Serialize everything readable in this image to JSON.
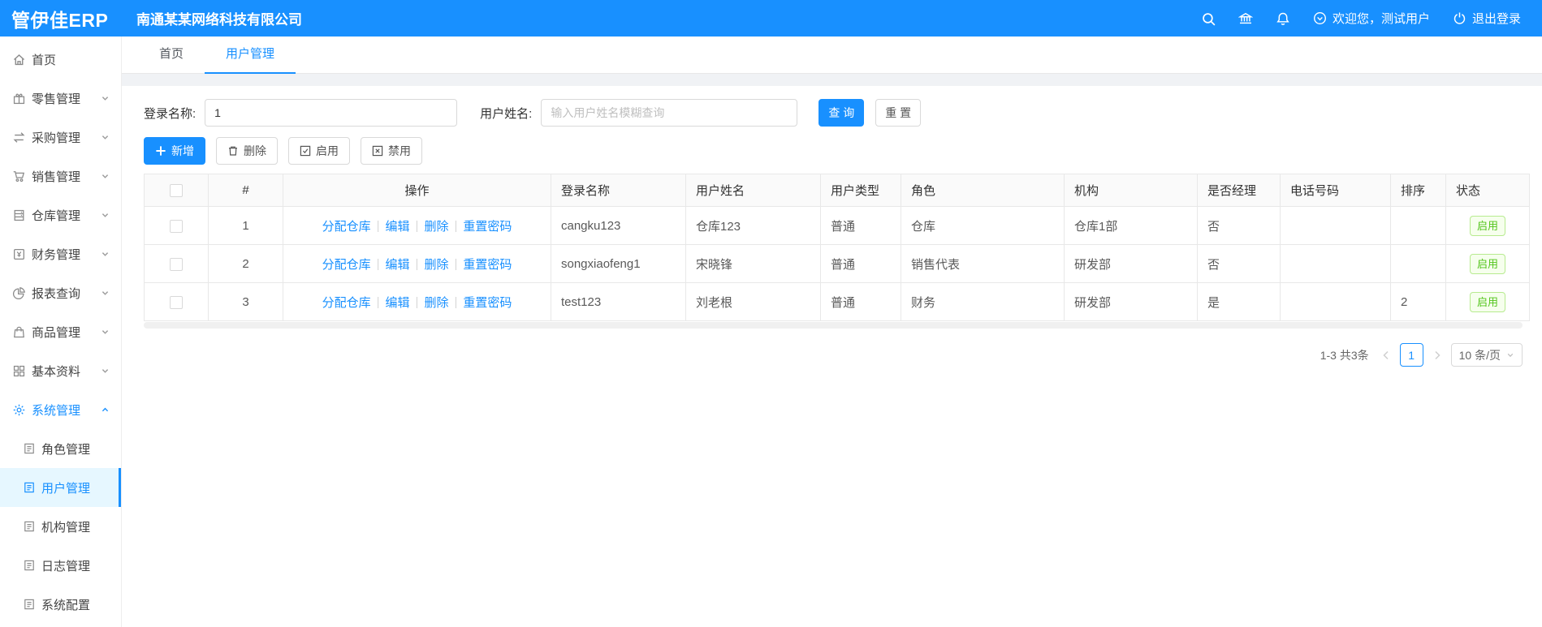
{
  "header": {
    "logo": "管伊佳ERP",
    "company": "南通某某网络科技有限公司",
    "welcome": "欢迎您，测试用户",
    "logout": "退出登录"
  },
  "sidebar": {
    "items": [
      {
        "label": "首页"
      },
      {
        "label": "零售管理"
      },
      {
        "label": "采购管理"
      },
      {
        "label": "销售管理"
      },
      {
        "label": "仓库管理"
      },
      {
        "label": "财务管理"
      },
      {
        "label": "报表查询"
      },
      {
        "label": "商品管理"
      },
      {
        "label": "基本资料"
      },
      {
        "label": "系统管理"
      }
    ],
    "submenu": [
      {
        "label": "角色管理"
      },
      {
        "label": "用户管理"
      },
      {
        "label": "机构管理"
      },
      {
        "label": "日志管理"
      },
      {
        "label": "系统配置"
      }
    ]
  },
  "tabs": {
    "home": "首页",
    "current": "用户管理"
  },
  "filters": {
    "login_name_label": "登录名称:",
    "login_name_value": "1",
    "user_name_label": "用户姓名:",
    "user_name_placeholder": "输入用户姓名模糊查询",
    "search_label": "查 询",
    "reset_label": "重 置"
  },
  "toolbar": {
    "add": "新增",
    "delete": "删除",
    "enable": "启用",
    "disable": "禁用"
  },
  "table": {
    "columns": [
      "",
      "#",
      "操作",
      "登录名称",
      "用户姓名",
      "用户类型",
      "角色",
      "机构",
      "是否经理",
      "电话号码",
      "排序",
      "状态"
    ],
    "action_links": [
      "分配仓库",
      "编辑",
      "删除",
      "重置密码"
    ],
    "rows": [
      {
        "index": "1",
        "login": "cangku123",
        "name": "仓库123",
        "type": "普通",
        "role": "仓库",
        "org": "仓库1部",
        "manager": "否",
        "phone": "",
        "sort": "",
        "status": "启用"
      },
      {
        "index": "2",
        "login": "songxiaofeng1",
        "name": "宋晓锋",
        "type": "普通",
        "role": "销售代表",
        "org": "研发部",
        "manager": "否",
        "phone": "",
        "sort": "",
        "status": "启用"
      },
      {
        "index": "3",
        "login": "test123",
        "name": "刘老根",
        "type": "普通",
        "role": "财务",
        "org": "研发部",
        "manager": "是",
        "phone": "",
        "sort": "2",
        "status": "启用"
      }
    ]
  },
  "pagination": {
    "total": "1-3 共3条",
    "page": "1",
    "page_size": "10 条/页"
  },
  "colors": {
    "primary": "#1890ff",
    "status_enabled": "#52c41a",
    "header_bg": "#1890ff",
    "active_menu_bg": "#e6f7ff"
  }
}
